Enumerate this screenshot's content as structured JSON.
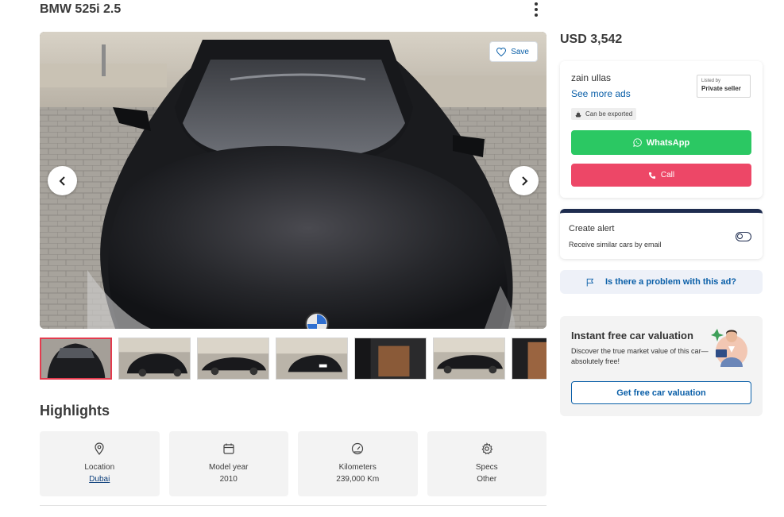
{
  "listing": {
    "title": "BMW 525i 2.5",
    "price": "USD 3,542",
    "save_label": "Save"
  },
  "thumbnails": [
    {
      "alt": "car front view"
    },
    {
      "alt": "car front angle"
    },
    {
      "alt": "car side front"
    },
    {
      "alt": "car rear"
    },
    {
      "alt": "car interior"
    },
    {
      "alt": "car side"
    },
    {
      "alt": "car interior seat"
    }
  ],
  "highlights": {
    "title": "Highlights",
    "items": [
      {
        "icon": "location-pin-icon",
        "label": "Location",
        "value": "Dubai"
      },
      {
        "icon": "calendar-icon",
        "label": "Model year",
        "value": "2010"
      },
      {
        "icon": "speedometer-icon",
        "label": "Kilometers",
        "value": "239,000 Km"
      },
      {
        "icon": "gear-icon",
        "label": "Specs",
        "value": "Other"
      }
    ]
  },
  "seller": {
    "name": "zain ullas",
    "see_more": "See more ads",
    "listed_by_label": "Listed by",
    "listed_by_value": "Private seller",
    "export_badge": "Can be exported",
    "whatsapp_label": "WhatsApp",
    "call_label": "Call"
  },
  "alert": {
    "title": "Create alert",
    "subtitle": "Receive similar cars by email"
  },
  "problem": {
    "label": "Is there a problem with this ad?"
  },
  "valuation": {
    "title": "Instant free car valuation",
    "description": "Discover the true market value of this car—absolutely free!",
    "button": "Get free car valuation"
  },
  "colors": {
    "whatsapp": "#2bc863",
    "call": "#ed4767",
    "link": "#0a5fa8",
    "alert_bar": "#1e2c4f",
    "thumb_active_border": "#e33b4e"
  }
}
